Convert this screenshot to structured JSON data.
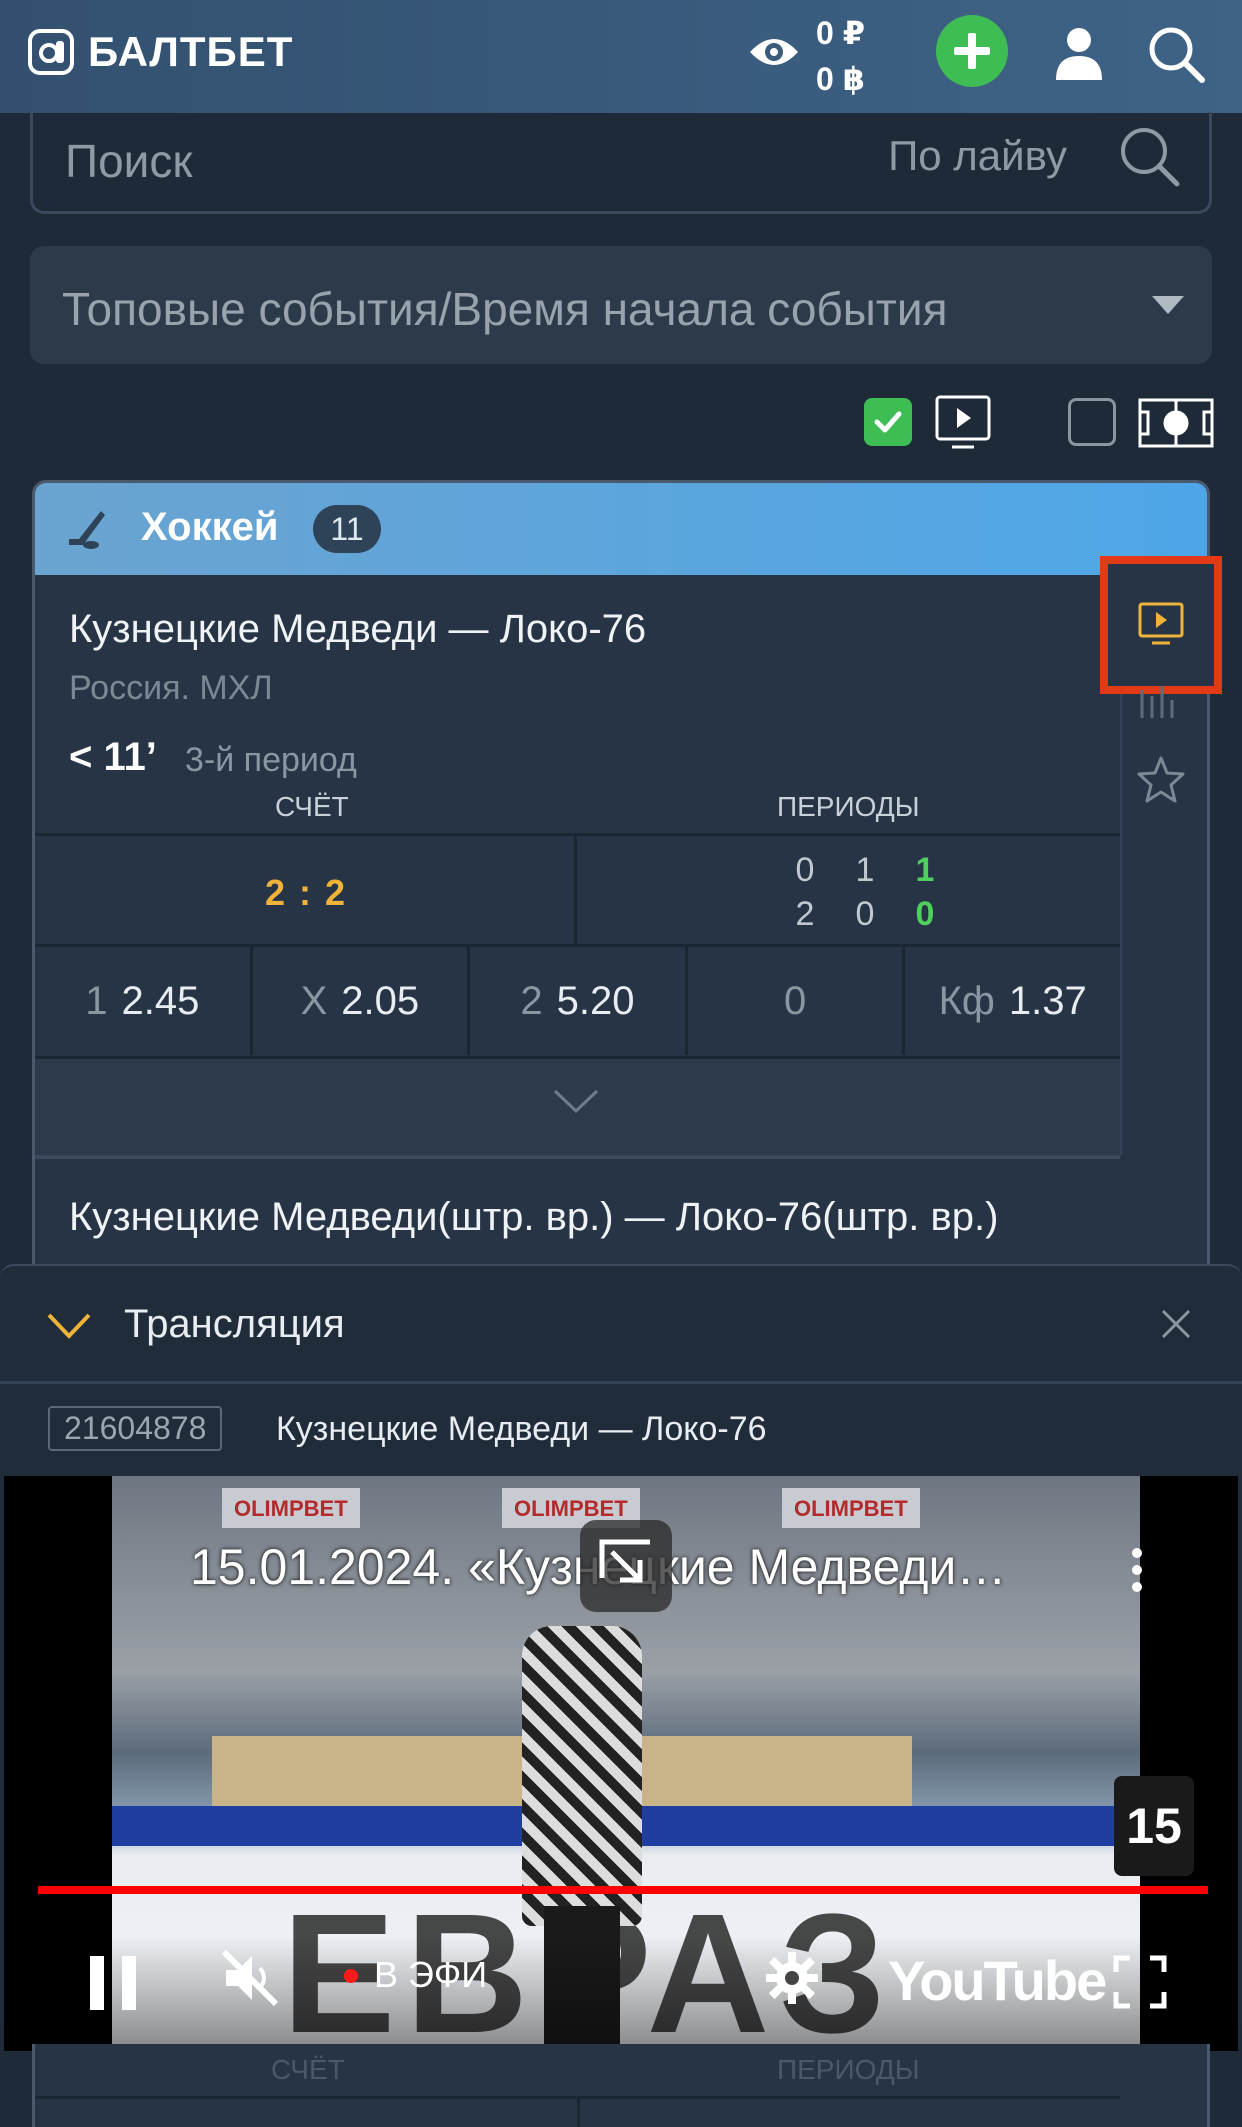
{
  "header": {
    "brand": "БАЛТБЕТ",
    "balance_rub": "0 ₽",
    "balance_bonus": "0 ฿"
  },
  "search": {
    "placeholder": "Поиск",
    "scope": "По лайву"
  },
  "filter": {
    "selected": "Топовые события/Время начала события"
  },
  "sport": {
    "name": "Хоккей",
    "count": "11"
  },
  "event": {
    "title": "Кузнецкие Медведи — Локо-76",
    "league": "Россия. МХЛ",
    "time": "< 11’",
    "period": "3-й период",
    "score_label": "СЧЁТ",
    "periods_label": "ПЕРИОДЫ",
    "score": "2 : 2",
    "periods_home": [
      "0",
      "1",
      "1"
    ],
    "periods_away": [
      "2",
      "0",
      "0"
    ],
    "odds": [
      {
        "key": "1",
        "value": "2.45"
      },
      {
        "key": "X",
        "value": "2.05"
      },
      {
        "key": "2",
        "value": "5.20"
      },
      {
        "key": "",
        "value": "0"
      },
      {
        "key": "Кф",
        "value": "1.37"
      }
    ]
  },
  "event2": {
    "title": "Кузнецкие Медведи(штр. вр.) — Локо-76(штр. вр.)"
  },
  "broadcast": {
    "title": "Трансляция",
    "event_id": "21604878",
    "match": "Кузнецкие Медведи — Локо-76",
    "video_title": "15.01.2024. «Кузнецкие Медведи…",
    "live_label": "В ЭФИ",
    "platform": "YouTube",
    "ads": [
      "OLIMPBET",
      "OLIMPBET",
      "OLIMPBET"
    ],
    "rink_text": "ЕВРАЗ",
    "badge": "15",
    "progress": 1.0
  },
  "below": {
    "score_label": "СЧЁТ",
    "periods_label": "ПЕРИОДЫ"
  }
}
